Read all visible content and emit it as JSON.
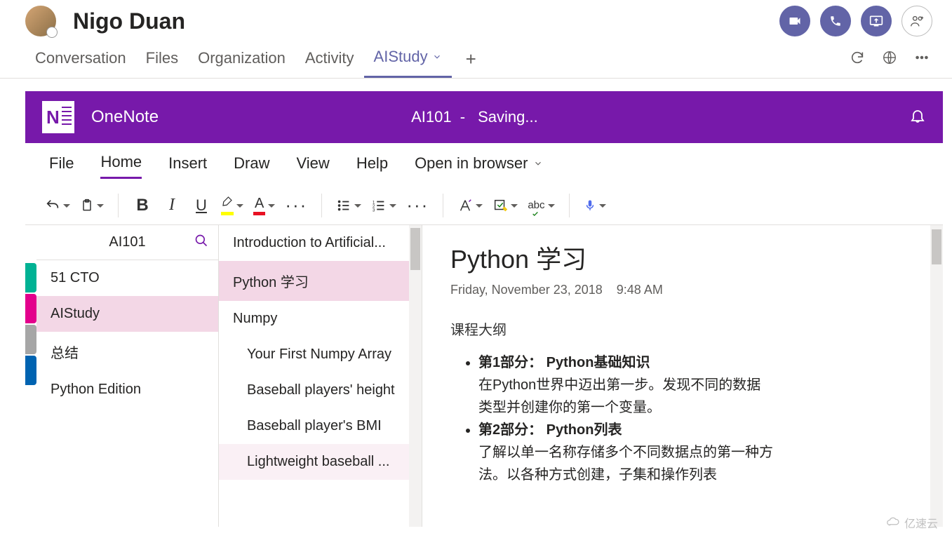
{
  "header": {
    "user_name": "Nigo Duan"
  },
  "tabs": {
    "items": [
      "Conversation",
      "Files",
      "Organization",
      "Activity",
      "AIStudy"
    ],
    "active_index": 4
  },
  "onenote": {
    "app_name": "OneNote",
    "doc_title": "AI101",
    "separator": "-",
    "status": "Saving..."
  },
  "menu": {
    "items": [
      "File",
      "Home",
      "Insert",
      "Draw",
      "View",
      "Help"
    ],
    "active_index": 1,
    "open_browser": "Open in browser"
  },
  "ribbon": {
    "bold": "B",
    "italic": "I",
    "underline": "U",
    "font_color": "A"
  },
  "notebook": {
    "name": "AI101",
    "sections": [
      {
        "label": "51 CTO"
      },
      {
        "label": "AIStudy"
      },
      {
        "label": "总结"
      },
      {
        "label": "Python Edition"
      }
    ],
    "active_section": 1,
    "pages": [
      {
        "label": "Introduction to Artificial...",
        "sub": false
      },
      {
        "label": "Python 学习",
        "sub": false
      },
      {
        "label": "Numpy",
        "sub": false
      },
      {
        "label": "Your First Numpy Array",
        "sub": true
      },
      {
        "label": "Baseball players' height",
        "sub": true
      },
      {
        "label": "Baseball player's BMI",
        "sub": true
      },
      {
        "label": "Lightweight baseball ...",
        "sub": true
      }
    ],
    "active_page": 1
  },
  "note": {
    "title": "Python 学习",
    "date": "Friday, November 23, 2018",
    "time": "9:48 AM",
    "subtitle": "课程大纲",
    "parts": [
      {
        "heading": "第1部分： Python基础知识",
        "body": "在Python世界中迈出第一步。发现不同的数据类型并创建你的第一个变量。"
      },
      {
        "heading": "第2部分： Python列表",
        "body": "了解以单一名称存储多个不同数据点的第一种方法。以各种方式创建，子集和操作列表"
      }
    ]
  },
  "watermark": "亿速云"
}
